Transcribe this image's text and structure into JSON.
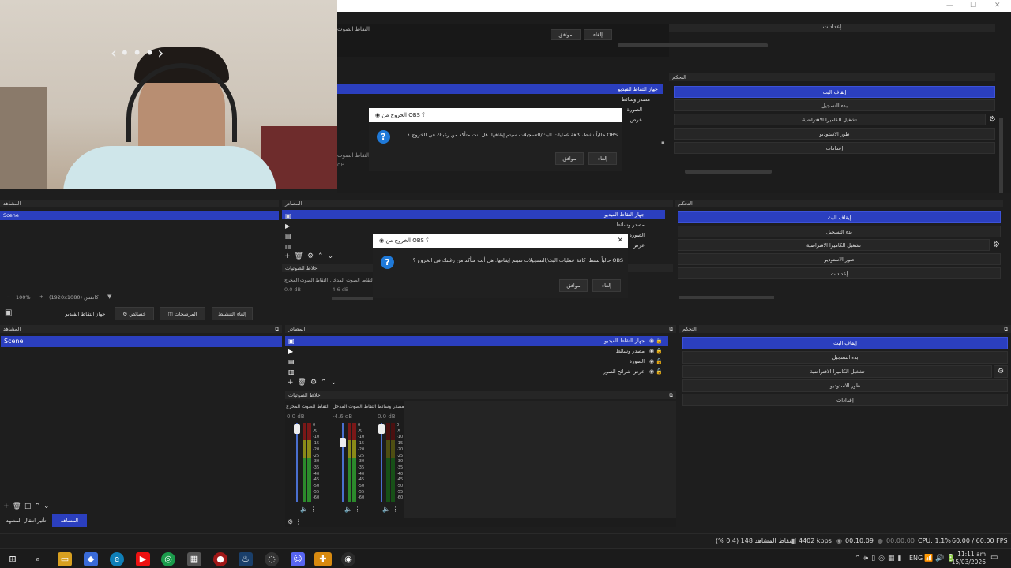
{
  "window": {
    "minimize": "—",
    "maximize": "☐",
    "close": "✕"
  },
  "nested_top": {
    "dialog_ok": "موافق",
    "dialog_cancel": "إلغاء",
    "settings": "إعدادات",
    "sources": [
      {
        "label": "جهاز التقاط الفيديو"
      },
      {
        "label": "مصدر وسائط"
      },
      {
        "label": "الصورة"
      },
      {
        "label": "عرض"
      }
    ],
    "audio_label": "التقاط الصوت",
    "audio_db": "dB",
    "controls_title": "التحكم",
    "controls": [
      "إيقاف البث",
      "بدء التسجيل",
      "تشغيل الكاميرا الافتراضية",
      "طور الاستوديو",
      "إعدادات"
    ],
    "dialog": {
      "title": "الخروج من OBS ؟",
      "message": "حالياً نشط، كافة عمليات البث/التسجيلات سيتم إيقافها. هل أنت متأكد من رغبتك في الخروج ؟ OBS",
      "ok": "موافق",
      "cancel": "إلغاء"
    }
  },
  "nested_mid": {
    "scenes_title": "المشاهد",
    "scene": "Scene",
    "sources_title": "المصادر",
    "sources": [
      {
        "label": "جهاز التقاط الفيديو"
      },
      {
        "label": "مصدر وسائط"
      },
      {
        "label": "الصورة"
      },
      {
        "label": "عرض"
      }
    ],
    "mixer_title": "خلاط الصوتيات",
    "mixer": [
      {
        "name": "التقاط الصوت المخرج",
        "db": "0.0 dB"
      },
      {
        "name": "التقاط الصوت المدخل",
        "db": "-4.6 dB"
      }
    ],
    "controls_title": "التحكم",
    "controls": [
      "إيقاف البث",
      "بدء التسجيل",
      "تشغيل الكاميرا الافتراضية",
      "طور الاستوديو",
      "إعدادات"
    ],
    "dialog": {
      "title": "الخروج من OBS ؟",
      "message": "حالياً نشط، كافة عمليات البث/التسجيلات سيتم إيقافها. هل أنت متأكد من رغبتك في الخروج ؟ OBS",
      "ok": "موافق",
      "cancel": "إلغاء"
    },
    "zoom": "100%",
    "canvas": "(1920x1080) كانفس"
  },
  "toolbar": {
    "device": "جهاز التقاط الفيديو",
    "props": "خصائص",
    "filters": "المرشحات",
    "deactivate": "إلغاء التنشيط"
  },
  "scenes": {
    "title": "المشاهد",
    "items": [
      "Scene"
    ]
  },
  "sources": {
    "title": "المصادر",
    "items": [
      "جهاز التقاط الفيديو",
      "مصدر وسائط",
      "الصورة",
      "عرض شرائح الصور"
    ]
  },
  "mixer": {
    "title": "خلاط الصوتيات",
    "channels": [
      {
        "name": "التقاط الصوت المخرج",
        "db": "0.0 dB"
      },
      {
        "name": "التقاط الصوت المدخل",
        "db": "-4.6 dB"
      },
      {
        "name": "مصدر وسائط",
        "db": "0.0 dB"
      }
    ],
    "scale": [
      "0",
      "-5",
      "-10",
      "-15",
      "-20",
      "-25",
      "-30",
      "-35",
      "-40",
      "-45",
      "-50",
      "-55",
      "-60"
    ]
  },
  "controls": {
    "title": "التحكم",
    "items": [
      "إيقاف البث",
      "بدء التسجيل",
      "تشغيل الكاميرا الافتراضية",
      "طور الاستوديو",
      "إعدادات"
    ]
  },
  "bottom_tabs": {
    "scenes": "المشاهد",
    "transitions": "تأثير انتقال المشهد"
  },
  "status": {
    "dropped": "إسقاط المشاهد 148 (0.4 %)",
    "kbps": "4402 kbps",
    "live_time": "00:10:09",
    "rec_time": "00:00:00",
    "cpu": "CPU: 1.1%",
    "fps": "60.00 / 60.00 FPS"
  },
  "taskbar": {
    "lang": "ENG",
    "time": "11:11 am",
    "date": "15/03/2026"
  },
  "colors": {
    "selected": "#2b3fbf",
    "background": "#1e1e1e",
    "meter_green": "#2c8a2c",
    "meter_yellow": "#8a8a18",
    "meter_red": "#7a1818"
  }
}
